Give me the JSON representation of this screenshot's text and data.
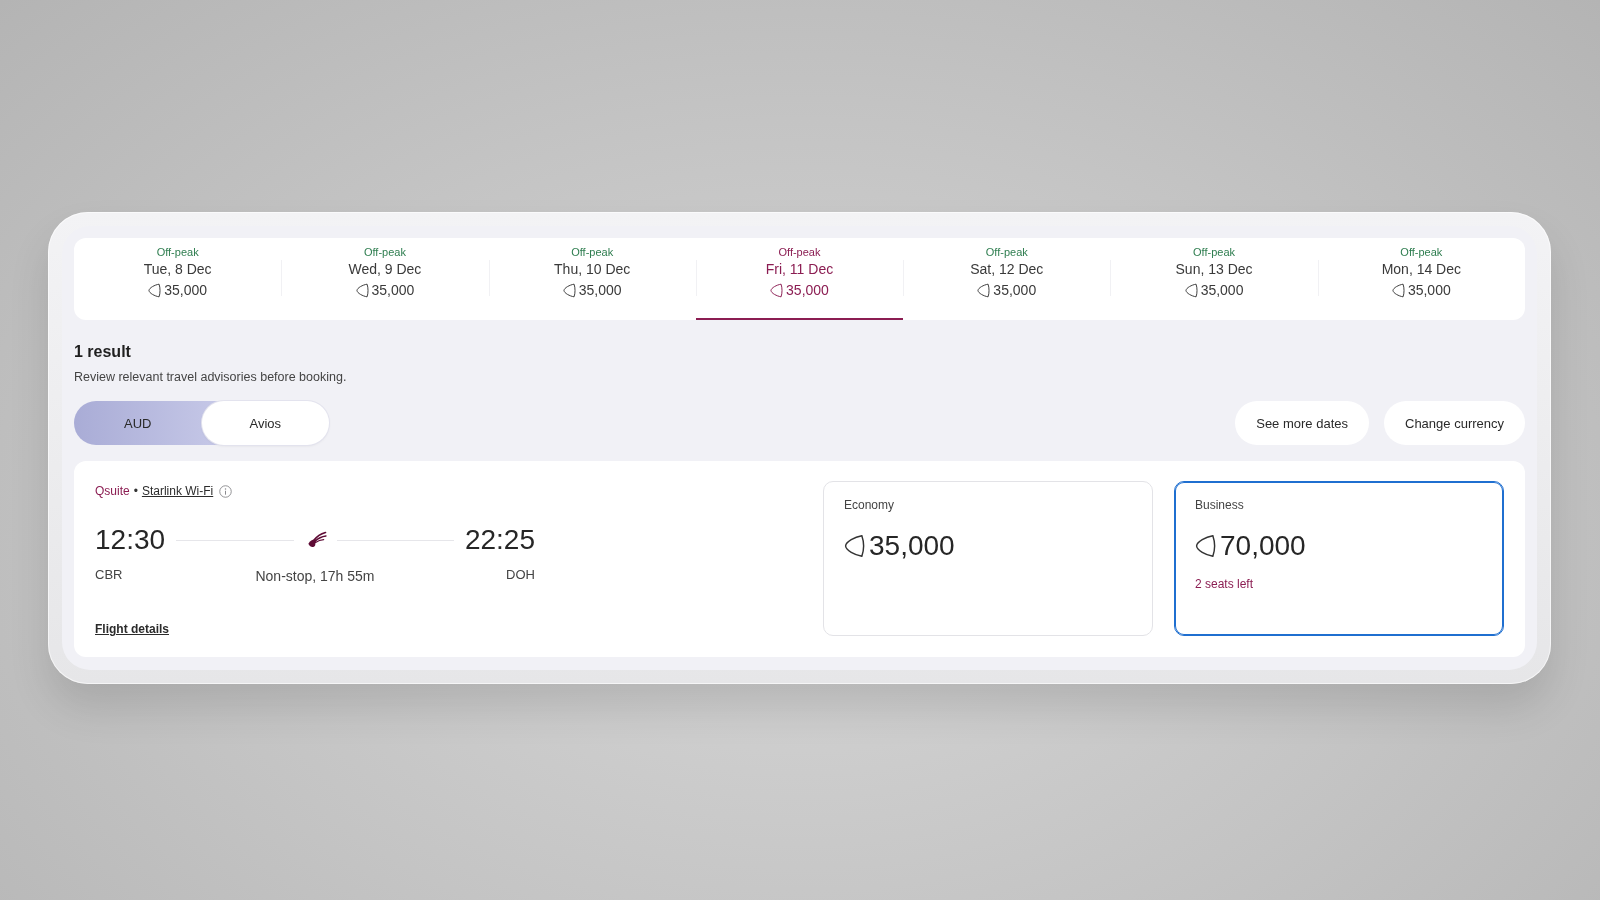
{
  "date_tabs": [
    {
      "tag": "Off-peak",
      "date": "Tue, 8 Dec",
      "price": "35,000",
      "selected": false
    },
    {
      "tag": "Off-peak",
      "date": "Wed, 9 Dec",
      "price": "35,000",
      "selected": false
    },
    {
      "tag": "Off-peak",
      "date": "Thu, 10 Dec",
      "price": "35,000",
      "selected": false
    },
    {
      "tag": "Off-peak",
      "date": "Fri, 11 Dec",
      "price": "35,000",
      "selected": true
    },
    {
      "tag": "Off-peak",
      "date": "Sat, 12 Dec",
      "price": "35,000",
      "selected": false
    },
    {
      "tag": "Off-peak",
      "date": "Sun, 13 Dec",
      "price": "35,000",
      "selected": false
    },
    {
      "tag": "Off-peak",
      "date": "Mon, 14 Dec",
      "price": "35,000",
      "selected": false
    }
  ],
  "results": {
    "count": "1 result",
    "notice": "Review relevant travel advisories before booking."
  },
  "currency_toggle": [
    {
      "label": "AUD",
      "selected": false
    },
    {
      "label": "Avios",
      "selected": true
    }
  ],
  "actions": [
    {
      "label": "See more dates"
    },
    {
      "label": "Change currency"
    }
  ],
  "flight": {
    "product": "Qsuite",
    "separator": "•",
    "wifi_link": "Starlink Wi-Fi",
    "departure": {
      "time": "12:30",
      "airport": "CBR"
    },
    "arrival": {
      "time": "22:25",
      "airport": "DOH"
    },
    "duration": "Non-stop, 17h 55m",
    "details_link": "Flight details"
  },
  "fares": [
    {
      "cabin": "Economy",
      "price": "35,000",
      "selected": false
    },
    {
      "cabin": "Business",
      "price": "70,000",
      "note": "2 seats left",
      "selected": true
    }
  ]
}
